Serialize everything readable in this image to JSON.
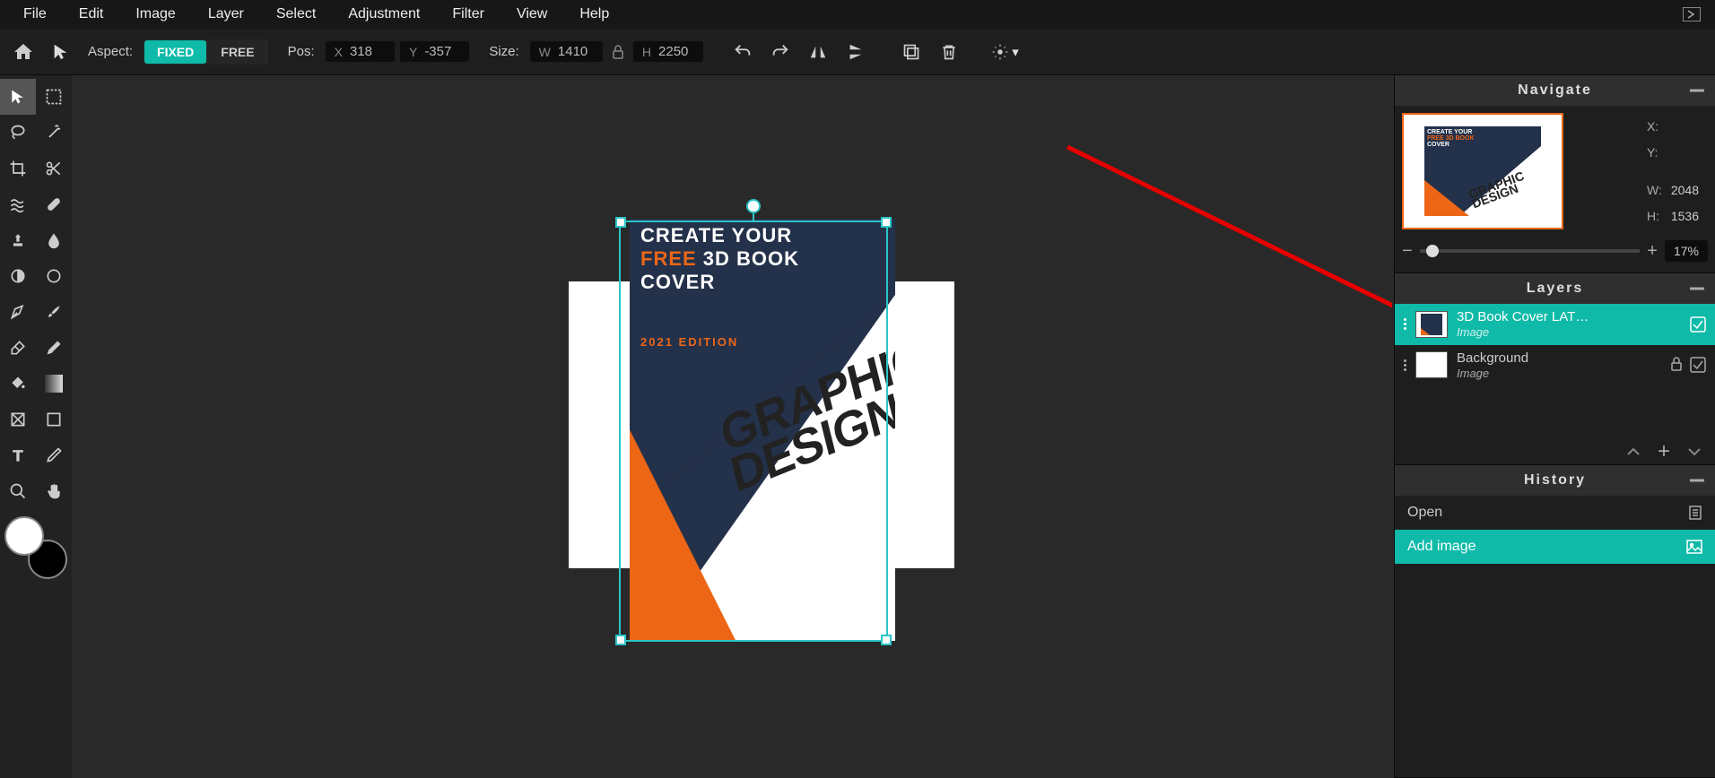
{
  "menu": [
    "File",
    "Edit",
    "Image",
    "Layer",
    "Select",
    "Adjustment",
    "Filter",
    "View",
    "Help"
  ],
  "optbar": {
    "aspect_label": "Aspect:",
    "fixed": "FIXED",
    "free": "FREE",
    "pos_label": "Pos:",
    "pos_x_label": "X",
    "pos_x": "318",
    "pos_y_label": "Y",
    "pos_y": "-357",
    "size_label": "Size:",
    "size_w_label": "W",
    "size_w": "1410",
    "size_h_label": "H",
    "size_h": "2250"
  },
  "navigate": {
    "title": "Navigate",
    "x_label": "X:",
    "x_val": "",
    "y_label": "Y:",
    "y_val": "",
    "w_label": "W:",
    "w_val": "2048",
    "h_label": "H:",
    "h_val": "1536",
    "zoom": "17%"
  },
  "layers": {
    "title": "Layers",
    "items": [
      {
        "name": "3D Book Cover LAT…",
        "type": "Image"
      },
      {
        "name": "Background",
        "type": "Image"
      }
    ]
  },
  "history": {
    "title": "History",
    "items": [
      "Open",
      "Add image"
    ]
  },
  "cover": {
    "line1": "CREATE YOUR",
    "line2a": "FREE",
    "line2b": " 3D BOOK",
    "line3": "COVER",
    "edition": "2021 EDITION",
    "graphic1": "GRAPHIC",
    "graphic2": "DESIGN"
  }
}
